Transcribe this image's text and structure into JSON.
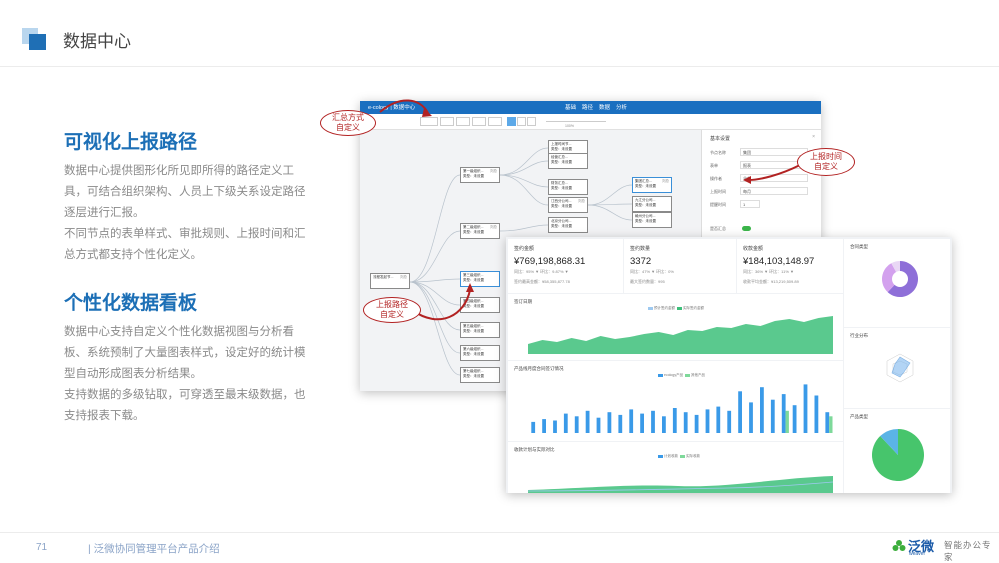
{
  "header": {
    "title": "数据中心"
  },
  "section1": {
    "title": "可视化上报路径",
    "lines": [
      "数据中心提供图形化所见即所得的路径定义工",
      "具，可结合组织架构、人员上下级关系设定路径",
      "逐层进行汇报。",
      "不同节点的表单样式、审批规则、上报时间和汇",
      "总方式都支持个性化定义。"
    ]
  },
  "section2": {
    "title": "个性化数据看板",
    "lines": [
      "数据中心支持自定义个性化数据视图与分析看",
      "板、系统预制了大量图表样式，设定好的统计模",
      "型自动形成图表分析结果。",
      "支持数据的多级钻取，可穿透至最末级数据，也",
      "支持报表下载。"
    ]
  },
  "callouts": {
    "summary": [
      "汇总方式",
      "自定义"
    ],
    "report_time": [
      "上报时间",
      "自定义"
    ],
    "report_path": [
      "上报路径",
      "自定义"
    ]
  },
  "editor": {
    "app_name": "e-cology | 数据中心",
    "nav": [
      "基础",
      "路径",
      "数据",
      "分析"
    ],
    "panel_title": "基本设置",
    "panel_rows": [
      {
        "label": "节点名称",
        "value": "集团"
      },
      {
        "label": "表单",
        "value": "报表"
      },
      {
        "label": "操作者",
        "value": "全部"
      },
      {
        "label": "上报时间",
        "value": "每月"
      },
      {
        "label": "提醒时间",
        "value": "1"
      },
      {
        "label": "是否汇总",
        "value": ""
      }
    ],
    "zoom": "100%"
  },
  "dashboard": {
    "kpis": [
      {
        "title": "签约金额",
        "value": "¥769,198,868.31",
        "sub1": "同比：95% ▼  环比：9.87% ▼",
        "sub2": "签约最高金额：¥58,355,877.78"
      },
      {
        "title": "签约数量",
        "value": "3372",
        "sub1": "同比：47% ▼  环比：0%",
        "sub2": "最大签约数量：995"
      },
      {
        "title": "收款金额",
        "value": "¥184,103,148.97",
        "sub1": "同比：36% ▼  环比：11% ▼",
        "sub2": "收款平均金额：¥13,219,509.89"
      }
    ],
    "panel_titles": [
      "签订日期",
      "产品线月度合同签订情况",
      "收款计划与实际对比",
      "合同类型",
      "行业分布",
      "产品类型"
    ],
    "legend1": [
      "预计签约金额",
      "实际签约金额"
    ],
    "legend2": [
      "ecology产品",
      "其他产品"
    ],
    "legend3": [
      "计划收款",
      "实际收款"
    ],
    "area_values": [
      10,
      14,
      12,
      16,
      13,
      18,
      15,
      17,
      20,
      22,
      19,
      24,
      23,
      27,
      26,
      30,
      28,
      33,
      35,
      32,
      36,
      38
    ],
    "bar_values": [
      8,
      10,
      9,
      14,
      12,
      16,
      11,
      15,
      13,
      17,
      14,
      16,
      12,
      18,
      15,
      13,
      17,
      19,
      16,
      30,
      22,
      33,
      24,
      28,
      20,
      35,
      27,
      15
    ],
    "bar_values2": [
      0,
      0,
      0,
      0,
      0,
      0,
      0,
      0,
      0,
      0,
      0,
      0,
      0,
      0,
      0,
      0,
      0,
      0,
      0,
      0,
      0,
      0,
      0,
      16,
      0,
      0,
      0,
      12
    ],
    "pie_values": [
      62,
      30,
      8
    ],
    "pie_colors": [
      "#8e6fd8",
      "#d3a1ee",
      "#e9d7f5"
    ],
    "donut_values": [
      88,
      12
    ],
    "donut_colors": [
      "#47c56c",
      "#5bb4e6"
    ]
  },
  "colors": {
    "accent": "#1c6fb6",
    "callout": "#b22222",
    "area": "#3dbf7a",
    "bars": "#3a9ae8"
  },
  "footer": {
    "page_number": "71",
    "text": "| 泛微协同管理平台产品介绍",
    "logo_cn": "泛微",
    "logo_en": "weaver",
    "slogan": "智能办公专家"
  }
}
